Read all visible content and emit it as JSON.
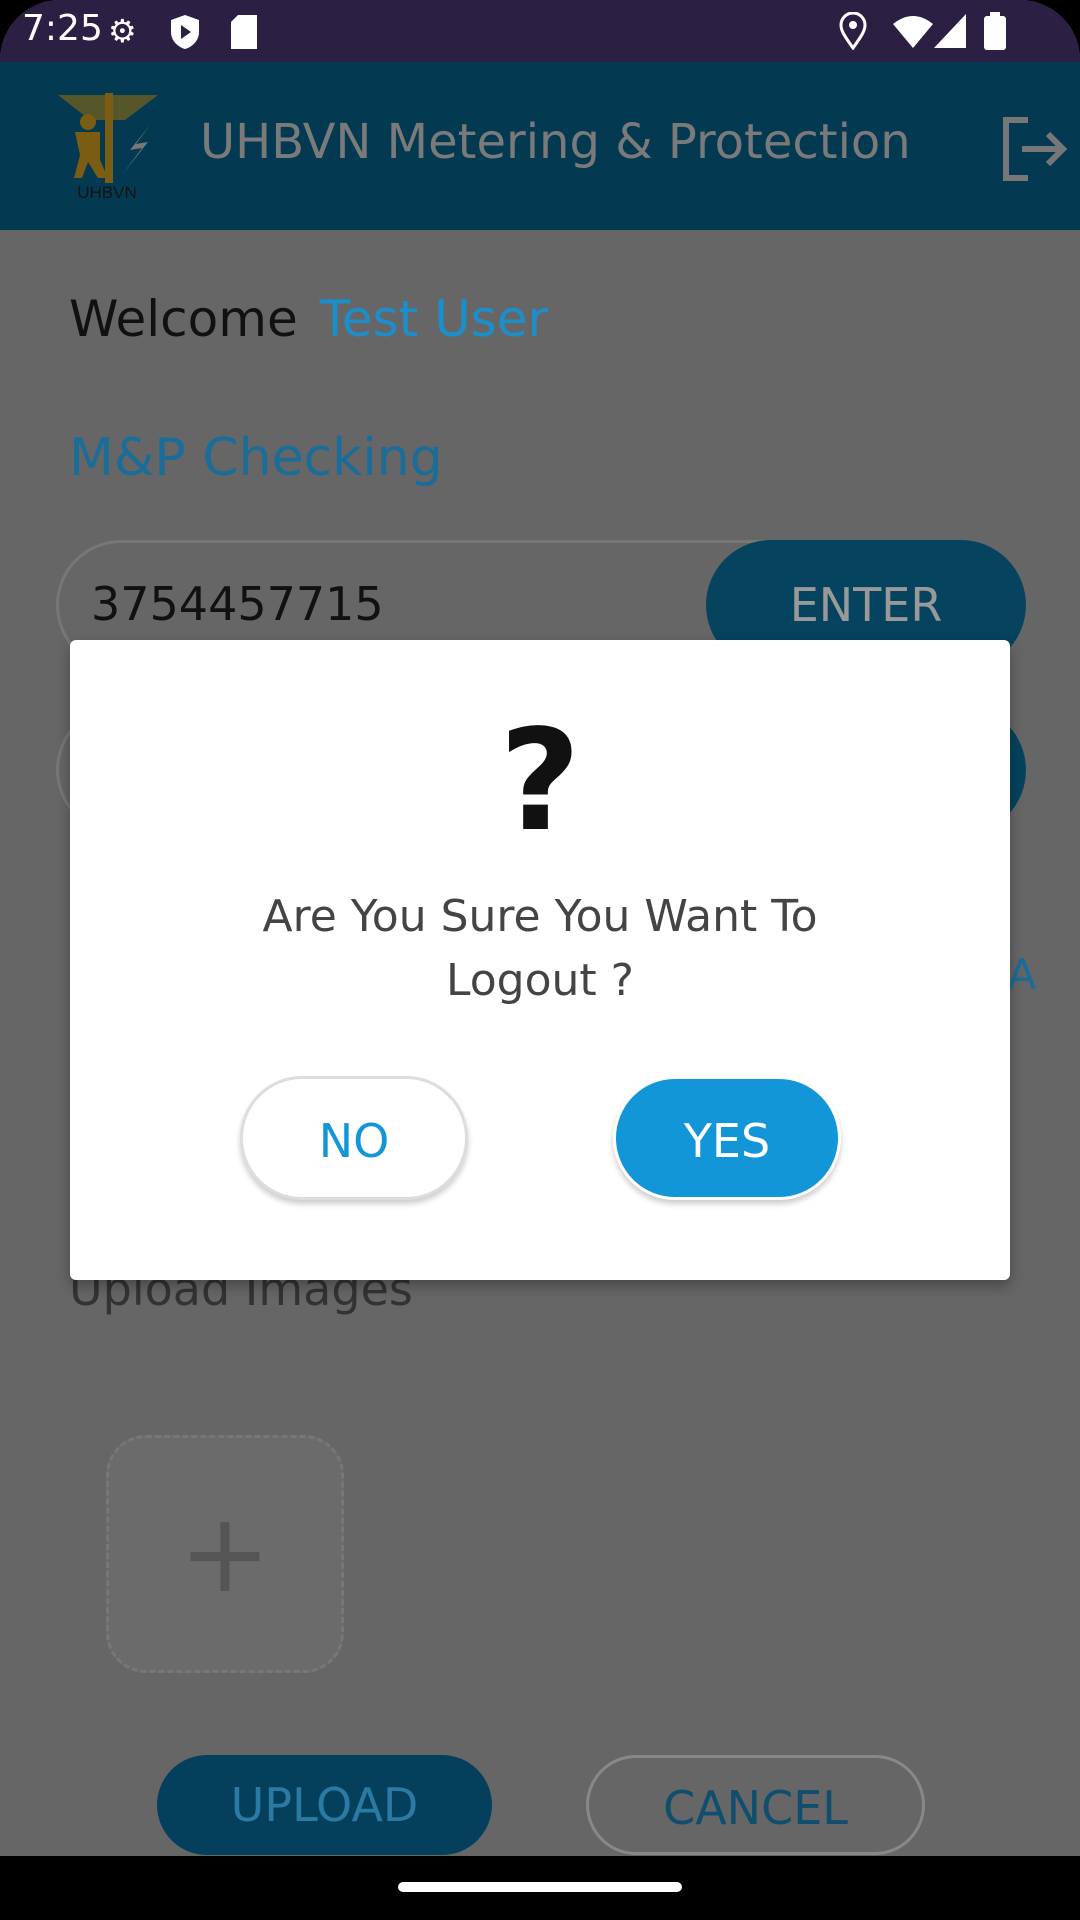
{
  "status_bar": {
    "time": "7:25",
    "icons": [
      "gear-icon",
      "shield-play-icon",
      "sd-card-icon",
      "location-icon",
      "wifi-icon",
      "signal-icon",
      "battery-icon"
    ]
  },
  "app_bar": {
    "title": "UHBVN Metering & Protection",
    "logo_text": "UHBVN",
    "logout_icon": "logout-icon"
  },
  "main": {
    "welcome_label": "Welcome",
    "user_name": "Test User",
    "section_title": "M&P Checking",
    "account_value": "3754457715",
    "enter_label": "ENTER",
    "camera_label": "RA",
    "upload_images_label": "Upload Images",
    "upload_label": "UPLOAD",
    "cancel_label": "CANCEL"
  },
  "dialog": {
    "icon": "?",
    "message": "Are You Sure You Want To Logout ?",
    "no_label": "NO",
    "yes_label": "YES"
  },
  "colors": {
    "accent": "#1296d7",
    "appbar": "#0a5f86",
    "status_bar": "#2b1f44"
  }
}
